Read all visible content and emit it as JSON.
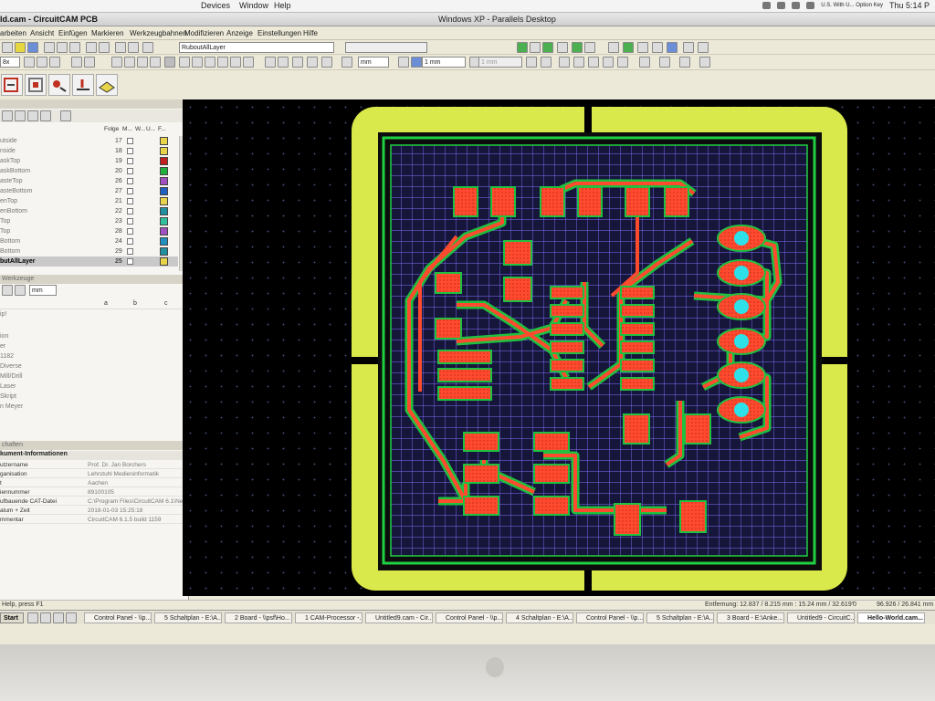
{
  "mac_menubar": {
    "items": [
      "Devices",
      "Window",
      "Help"
    ],
    "keyboard": "U.S. With U... Option Key",
    "clock": "Thu 5:14 P"
  },
  "window": {
    "app_title": "ld.cam - CircuitCAM PCB",
    "parallels_title": "Windows XP - Parallels Desktop"
  },
  "menu": [
    "arbeiten",
    "Ansicht",
    "Einfügen",
    "Markieren",
    "Werkzeugbahnen",
    "Modifizieren",
    "Anzeige",
    "Einstellungen",
    "Hilfe"
  ],
  "toolbar": {
    "layer_select": "RuboutAllLayer",
    "zoom_label": "8x",
    "unit1": "mm",
    "linewidth": "1 mm",
    "linewidth2": "1 mm"
  },
  "layers": {
    "columns": [
      "Folge",
      "M...",
      "W...",
      "U...",
      "F..."
    ],
    "rows": [
      {
        "name": "utside",
        "order": "17",
        "color": "#e8d44a"
      },
      {
        "name": "nside",
        "order": "18",
        "color": "#e8d44a"
      },
      {
        "name": "askTop",
        "order": "19",
        "color": "#c02020"
      },
      {
        "name": "askBottom",
        "order": "20",
        "color": "#20b040"
      },
      {
        "name": "asteTop",
        "order": "26",
        "color": "#a050c0"
      },
      {
        "name": "asteBottom",
        "order": "27",
        "color": "#2060c0"
      },
      {
        "name": "enTop",
        "order": "21",
        "color": "#e8d44a"
      },
      {
        "name": "enBottom",
        "order": "22",
        "color": "#2090a0"
      },
      {
        "name": "Top",
        "order": "23",
        "color": "#30c0a0"
      },
      {
        "name": "Top",
        "order": "28",
        "color": "#a050c0"
      },
      {
        "name": "Bottom",
        "order": "24",
        "color": "#2090c0"
      },
      {
        "name": "Bottom",
        "order": "29",
        "color": "#2090a0"
      },
      {
        "name": "butAllLayer",
        "order": "25",
        "color": "#e8d44a",
        "active": true
      }
    ]
  },
  "properties": {
    "title": "Werkzeuge",
    "unit": "mm",
    "cols": [
      "a",
      "b",
      "c"
    ],
    "rows": [
      "ion",
      "er",
      "1182",
      "Diverse",
      "Mill/Drill",
      "Laser",
      "Skript",
      "n Meyer"
    ]
  },
  "doc_info": {
    "panel_title": "chaften",
    "heading": "kument-Informationen",
    "rows": [
      {
        "key": "utzername",
        "value": "Prof. Dr. Jan Borchers"
      },
      {
        "key": "ganisation",
        "value": "Lehrstuhl Medieninformatik"
      },
      {
        "key": "t",
        "value": "Aachen"
      },
      {
        "key": "iennummer",
        "value": "89100105"
      },
      {
        "key": "ufbauende CAT-Datei",
        "value": "C:\\Program Files\\CircuitCAM 6.1\\Ne"
      },
      {
        "key": "atum + Zeit",
        "value": "2018-01-03 15:25:18"
      },
      {
        "key": "mmentar",
        "value": "CircuitCAM 6.1.5 build 1159"
      }
    ]
  },
  "status": {
    "help": "Help, press F1",
    "distance": "Entfernung: 12.837 / 8.215 mm : 15.24 mm / 32.619°",
    "zero": "0",
    "coords": "96.926 / 26.841 mm"
  },
  "taskbar": {
    "start": "Start",
    "tasks": [
      "Control Panel - \\\\p...",
      "5 Schaltplan - E:\\A...",
      "2 Board - \\\\psf\\Ho...",
      "1 CAM-Processor -...",
      "Untitled9.cam - Cir...",
      "Control Panel - \\\\p...",
      "4 Schaltplan - E:\\A...",
      "Control Panel - \\\\p...",
      "5 Schaltplan - E:\\A...",
      "3 Board - E:\\Anke...",
      "Untitled9 - CircuitC...",
      "Hello-World.cam..."
    ]
  }
}
